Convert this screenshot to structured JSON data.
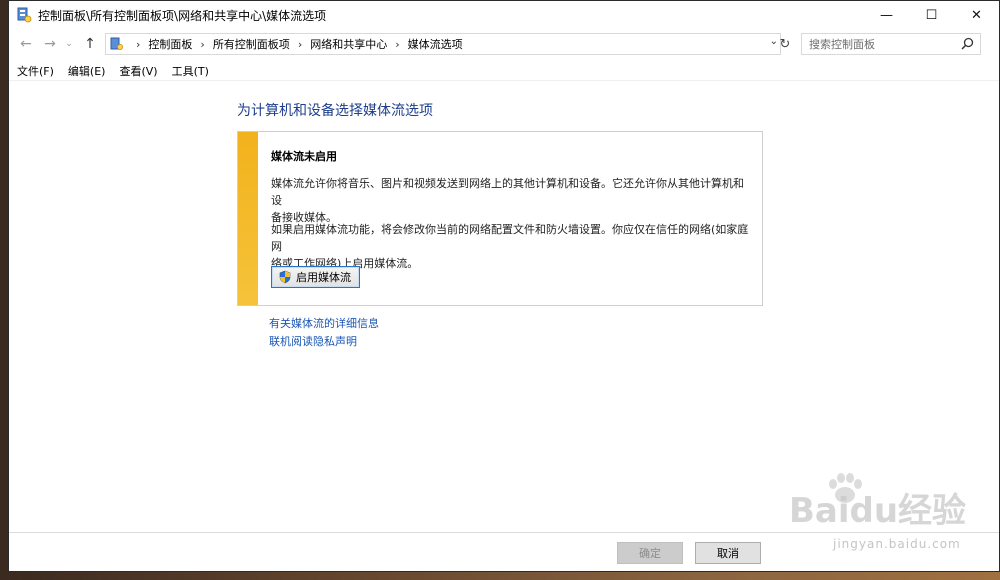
{
  "window": {
    "title": "控制面板\\所有控制面板项\\网络和共享中心\\媒体流选项",
    "icon": "control-panel-icon",
    "controls": {
      "minimize": "—",
      "maximize": "☐",
      "close": "✕"
    }
  },
  "address": {
    "breadcrumbs": [
      "控制面板",
      "所有控制面板项",
      "网络和共享中心",
      "媒体流选项"
    ],
    "search_placeholder": "搜索控制面板"
  },
  "menu": [
    "文件(F)",
    "编辑(E)",
    "查看(V)",
    "工具(T)"
  ],
  "main": {
    "heading": "为计算机和设备选择媒体流选项",
    "info": {
      "title": "媒体流未启用",
      "para1_line1": "媒体流允许你将音乐、图片和视频发送到网络上的其他计算机和设备。它还允许你从其他计算机和设",
      "para1_line2": "备接收媒体。",
      "para2_line1": "如果启用媒体流功能，将会修改你当前的网络配置文件和防火墙设置。你应仅在信任的网络(如家庭网",
      "para2_line2": "络或工作网络)上启用媒体流。",
      "enable_button": "启用媒体流"
    },
    "links": [
      "有关媒体流的详细信息",
      "联机阅读隐私声明"
    ]
  },
  "footer": {
    "ok": "确定",
    "cancel": "取消"
  },
  "watermark": {
    "brand": "Baidu经验",
    "url": "jingyan.baidu.com"
  },
  "colors": {
    "accent_bar": "#f2b21c",
    "heading": "#1e3f8c",
    "link": "#1a56b5"
  }
}
